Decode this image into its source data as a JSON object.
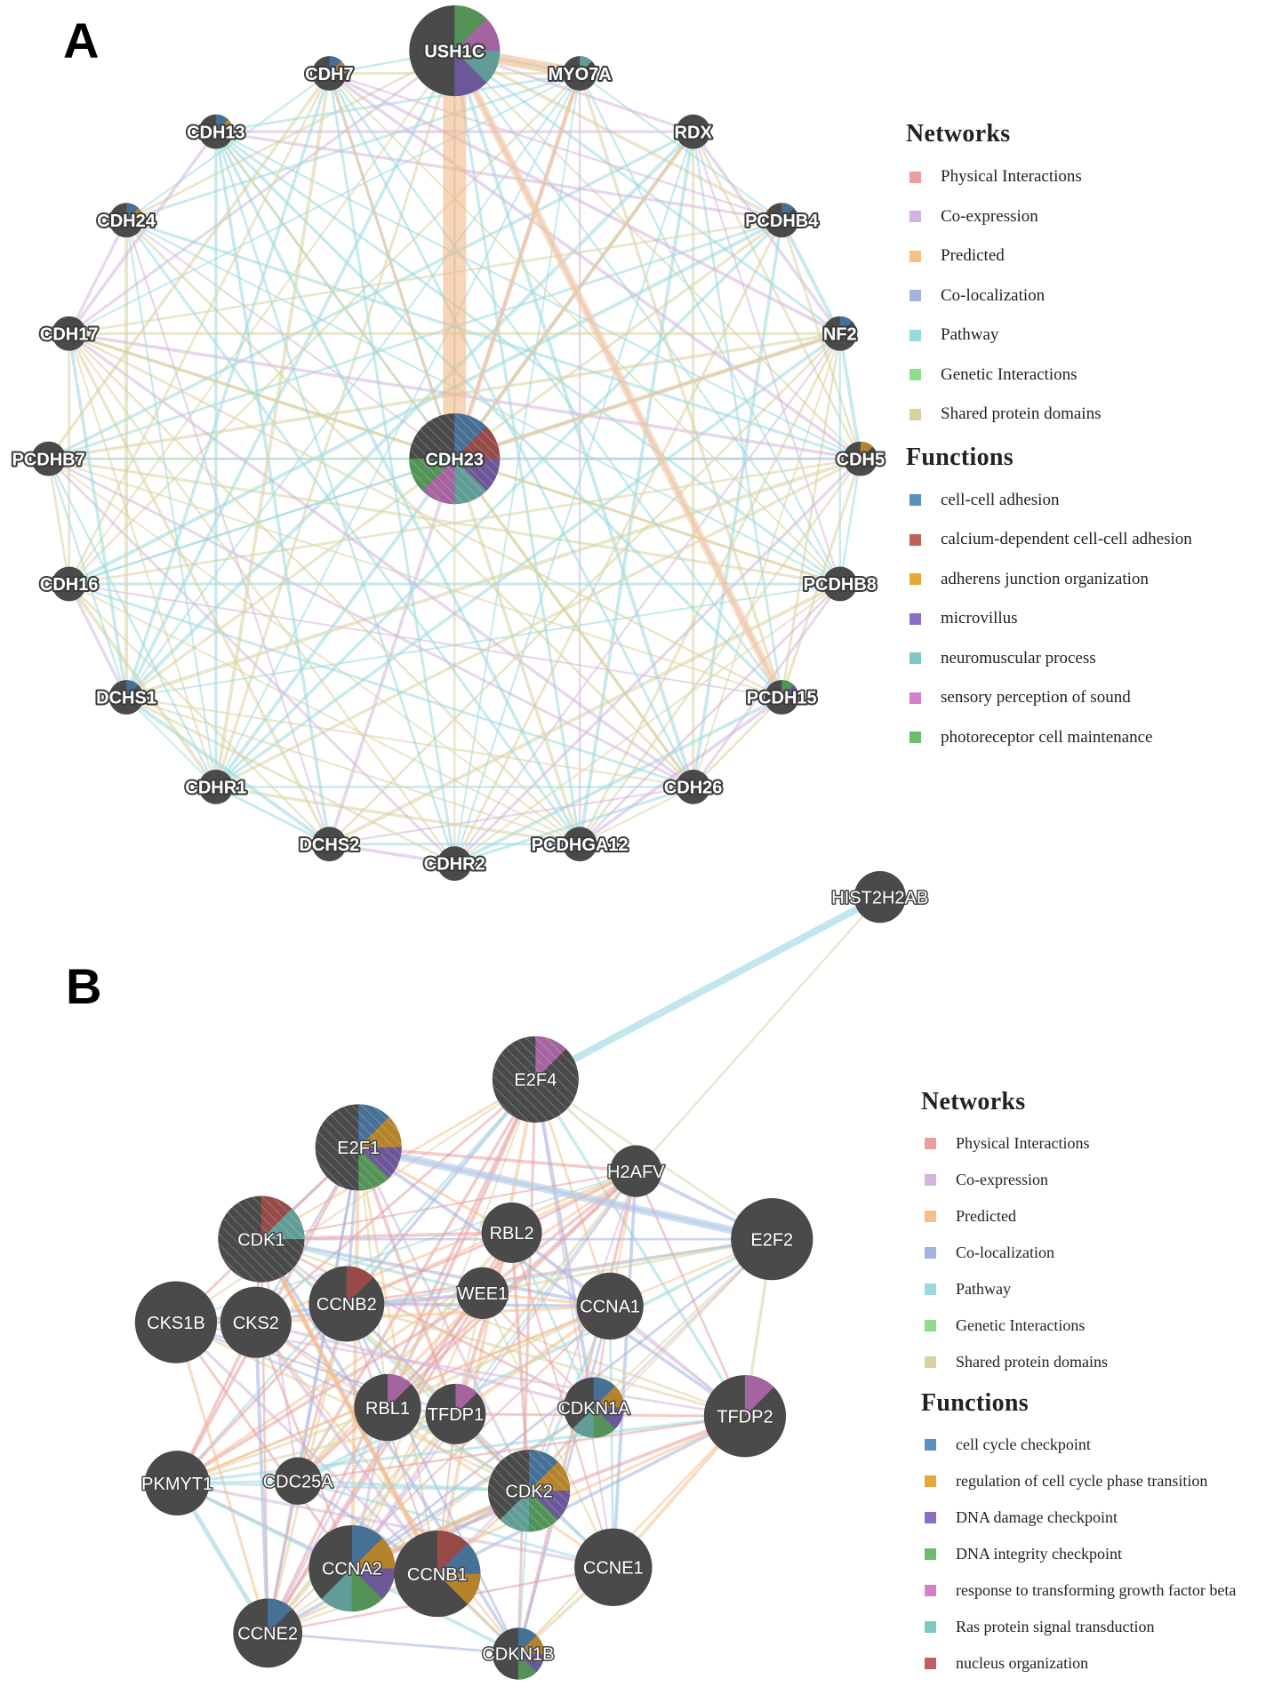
{
  "figure": {
    "panels": [
      {
        "letter": "A",
        "legend": {
          "networks_title": "Networks",
          "networks": [
            {
              "label": "Physical Interactions",
              "color": "#e8a0a0"
            },
            {
              "label": "Co-expression",
              "color": "#d4b4dc"
            },
            {
              "label": "Predicted",
              "color": "#f5c08a"
            },
            {
              "label": "Co-localization",
              "color": "#a3b3e0"
            },
            {
              "label": "Pathway",
              "color": "#9bd8de"
            },
            {
              "label": "Genetic Interactions",
              "color": "#8fdc8a"
            },
            {
              "label": "Shared protein domains",
              "color": "#d8d2a0"
            }
          ],
          "functions_title": "Functions",
          "functions": [
            {
              "label": "cell-cell adhesion",
              "color": "#5b8fc0"
            },
            {
              "label": "calcium-dependent cell-cell adhesion",
              "color": "#c0605c"
            },
            {
              "label": "adherens junction organization",
              "color": "#e8a838"
            },
            {
              "label": "microvillus",
              "color": "#8a70c4"
            },
            {
              "label": "neuromuscular process",
              "color": "#7ec8c0"
            },
            {
              "label": "sensory perception of sound",
              "color": "#d480cc"
            },
            {
              "label": "photoreceptor cell maintenance",
              "color": "#6cbc70"
            }
          ]
        },
        "nodes": [
          {
            "id": "USH1C",
            "query": true
          },
          {
            "id": "CDH23",
            "query": true
          },
          {
            "id": "MYO7A"
          },
          {
            "id": "RDX"
          },
          {
            "id": "PCDHB4"
          },
          {
            "id": "NF2"
          },
          {
            "id": "CDH5"
          },
          {
            "id": "PCDHB8"
          },
          {
            "id": "PCDH15"
          },
          {
            "id": "CDH26"
          },
          {
            "id": "PCDHGA12"
          },
          {
            "id": "CDHR2"
          },
          {
            "id": "DCHS2"
          },
          {
            "id": "CDHR1"
          },
          {
            "id": "DCHS1"
          },
          {
            "id": "CDH16"
          },
          {
            "id": "PCDHB7"
          },
          {
            "id": "CDH17"
          },
          {
            "id": "CDH24"
          },
          {
            "id": "CDH13"
          },
          {
            "id": "CDH7"
          }
        ],
        "node_functions": {
          "USH1C": [
            "photoreceptor cell maintenance",
            "sensory perception of sound",
            "neuromuscular process",
            "microvillus"
          ],
          "CDH23": [
            "cell-cell adhesion",
            "calcium-dependent cell-cell adhesion",
            "microvillus",
            "neuromuscular process",
            "sensory perception of sound",
            "photoreceptor cell maintenance"
          ],
          "MYO7A": [
            "neuromuscular process"
          ],
          "CDH7": [
            "cell-cell adhesion",
            "adherens junction organization"
          ],
          "CDH13": [
            "cell-cell adhesion",
            "adherens junction organization"
          ],
          "CDH24": [
            "cell-cell adhesion",
            "adherens junction organization"
          ],
          "PCDHB4": [
            "cell-cell adhesion"
          ],
          "NF2": [
            "cell-cell adhesion"
          ],
          "CDH5": [
            "adherens junction organization"
          ],
          "PCDH15": [
            "photoreceptor cell maintenance",
            "microvillus"
          ],
          "DCHS1": [
            "cell-cell adhesion"
          ]
        }
      },
      {
        "letter": "B",
        "legend": {
          "networks_title": "Networks",
          "networks": [
            {
              "label": "Physical Interactions",
              "color": "#e8a0a0"
            },
            {
              "label": "Co-expression",
              "color": "#d4b4dc"
            },
            {
              "label": "Predicted",
              "color": "#f5c08a"
            },
            {
              "label": "Co-localization",
              "color": "#a3b3e0"
            },
            {
              "label": "Pathway",
              "color": "#9bd8de"
            },
            {
              "label": "Genetic Interactions",
              "color": "#8fdc8a"
            },
            {
              "label": "Shared protein domains",
              "color": "#d8d2a0"
            }
          ],
          "functions_title": "Functions",
          "functions": [
            {
              "label": "cell cycle checkpoint",
              "color": "#5b8fc0"
            },
            {
              "label": "regulation of cell cycle phase transition",
              "color": "#e8a838"
            },
            {
              "label": "DNA damage checkpoint",
              "color": "#8a70c4"
            },
            {
              "label": "DNA integrity checkpoint",
              "color": "#6cbc70"
            },
            {
              "label": "response to transforming growth factor beta",
              "color": "#d480cc"
            },
            {
              "label": "Ras protein signal transduction",
              "color": "#7ec8c0"
            },
            {
              "label": "nucleus organization",
              "color": "#c0605c"
            }
          ]
        },
        "nodes": [
          {
            "id": "HIST2H2AB"
          },
          {
            "id": "E2F4",
            "query": true
          },
          {
            "id": "E2F1",
            "query": true
          },
          {
            "id": "H2AFV"
          },
          {
            "id": "E2F2"
          },
          {
            "id": "CDK1",
            "query": true
          },
          {
            "id": "RBL2"
          },
          {
            "id": "WEE1"
          },
          {
            "id": "CCNB2"
          },
          {
            "id": "CCNA1"
          },
          {
            "id": "CKS1B"
          },
          {
            "id": "CKS2"
          },
          {
            "id": "RBL1"
          },
          {
            "id": "TFDP1"
          },
          {
            "id": "CDKN1A"
          },
          {
            "id": "TFDP2"
          },
          {
            "id": "PKMYT1"
          },
          {
            "id": "CDC25A"
          },
          {
            "id": "CDK2",
            "query": true
          },
          {
            "id": "CCNA2"
          },
          {
            "id": "CCNB1"
          },
          {
            "id": "CCNE1"
          },
          {
            "id": "CCNE2"
          },
          {
            "id": "CDKN1B"
          }
        ],
        "node_functions": {
          "E2F4": [
            "response to transforming growth factor beta"
          ],
          "E2F1": [
            "cell cycle checkpoint",
            "regulation of cell cycle phase transition",
            "DNA damage checkpoint",
            "DNA integrity checkpoint"
          ],
          "CDK1": [
            "nucleus organization",
            "Ras protein signal transduction"
          ],
          "CCNB2": [
            "nucleus organization"
          ],
          "RBL1": [
            "response to transforming growth factor beta"
          ],
          "TFDP1": [
            "response to transforming growth factor beta"
          ],
          "CDKN1A": [
            "cell cycle checkpoint",
            "regulation of cell cycle phase transition",
            "DNA damage checkpoint",
            "DNA integrity checkpoint",
            "Ras protein signal transduction"
          ],
          "TFDP2": [
            "response to transforming growth factor beta"
          ],
          "CDK2": [
            "cell cycle checkpoint",
            "regulation of cell cycle phase transition",
            "DNA damage checkpoint",
            "DNA integrity checkpoint",
            "Ras protein signal transduction"
          ],
          "CCNA2": [
            "cell cycle checkpoint",
            "regulation of cell cycle phase transition",
            "DNA damage checkpoint",
            "DNA integrity checkpoint",
            "Ras protein signal transduction"
          ],
          "CCNB1": [
            "nucleus organization",
            "cell cycle checkpoint",
            "regulation of cell cycle phase transition"
          ],
          "CCNE2": [
            "cell cycle checkpoint"
          ],
          "CDKN1B": [
            "cell cycle checkpoint",
            "regulation of cell cycle phase transition",
            "DNA damage checkpoint",
            "DNA integrity checkpoint"
          ]
        }
      }
    ]
  }
}
